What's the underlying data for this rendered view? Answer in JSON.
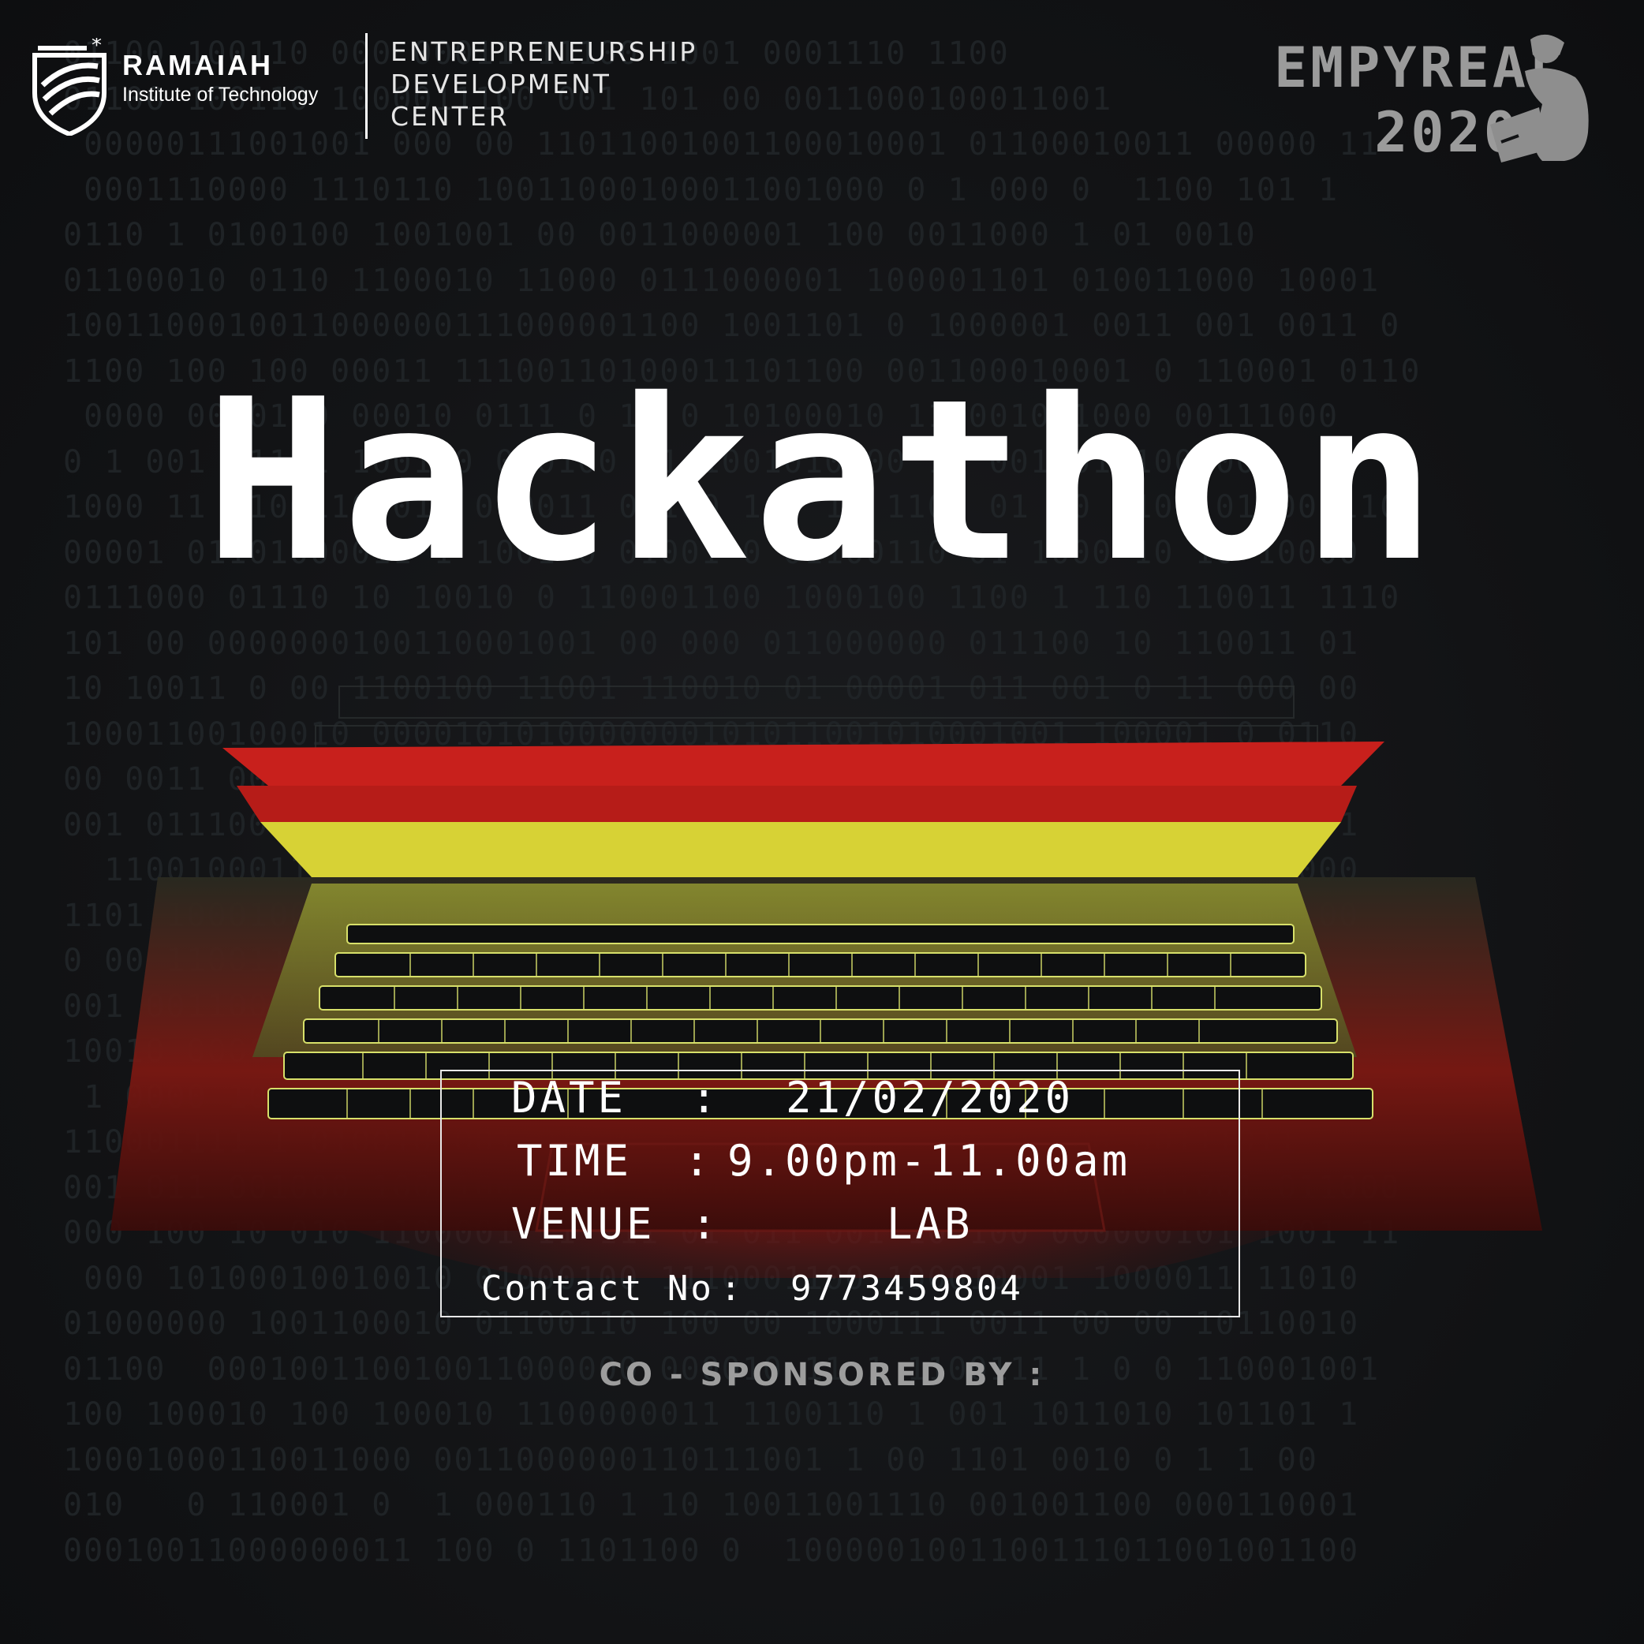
{
  "header": {
    "institute_name": "RAMAIAH",
    "institute_sub": "Institute of Technology",
    "center_line1": "ENTREPRENEURSHIP",
    "center_line2": "DEVELOPMENT",
    "center_line3": "CENTER",
    "event_line1": "EMPYREAL",
    "event_line2": "2020"
  },
  "title": "Hackathon",
  "details": {
    "date_label": "DATE",
    "date_sep": ":",
    "date_value": "21/02/2020",
    "time_label": "TIME",
    "time_sep": ":",
    "time_value": "9.00pm-11.00am",
    "venue_label": "VENUE",
    "venue_sep": ":",
    "venue_value": "LAB",
    "contact_label": "Contact No",
    "contact_sep": ":",
    "contact_value": "9773459804"
  },
  "cosponsor_label": "CO - SPONSORED BY :",
  "icons": [
    "ramaiah-logo-icon",
    "hacker-laptop-icon",
    "laptop-image"
  ],
  "colors": {
    "background": "#121315",
    "laptop_red": "#c8201c",
    "laptop_yellow": "#d7d235",
    "text": "#ffffff",
    "muted": "#9b9b9b"
  }
}
